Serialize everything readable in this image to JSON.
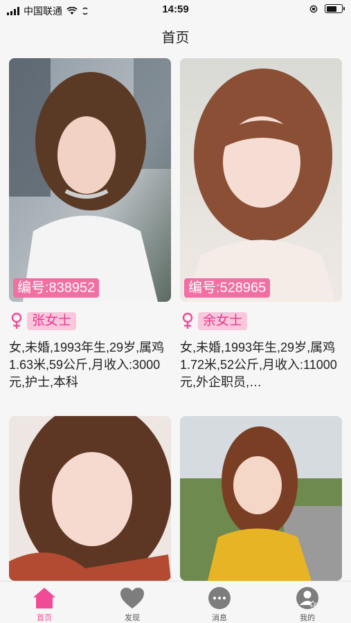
{
  "status_bar": {
    "carrier": "中国联通",
    "time": "14:59",
    "battery_level": 0.8
  },
  "nav": {
    "title": "首页"
  },
  "cards": [
    {
      "id_label": "编号:838952",
      "name": "张女士",
      "desc": "女,未婚,1993年生,29岁,属鸡 1.63米,59公斤,月收入:3000元,护士,本科"
    },
    {
      "id_label": "编号:528965",
      "name": "余女士",
      "desc": "女,未婚,1993年生,29岁,属鸡 1.72米,52公斤,月收入:11000元,外企职员,…"
    },
    {
      "id_label": "",
      "name": "",
      "desc": ""
    },
    {
      "id_label": "",
      "name": "",
      "desc": ""
    }
  ],
  "tabs": [
    {
      "label": "首页",
      "icon": "home-icon",
      "active": true
    },
    {
      "label": "发现",
      "icon": "heart-icon",
      "active": false
    },
    {
      "label": "消息",
      "icon": "message-icon",
      "active": false
    },
    {
      "label": "我的",
      "icon": "profile-icon",
      "active": false
    }
  ],
  "colors": {
    "accent": "#f04b95",
    "badge": "#f16fa3",
    "name_tag_bg": "#f9c8dd",
    "name_tag_text": "#e9378f"
  }
}
